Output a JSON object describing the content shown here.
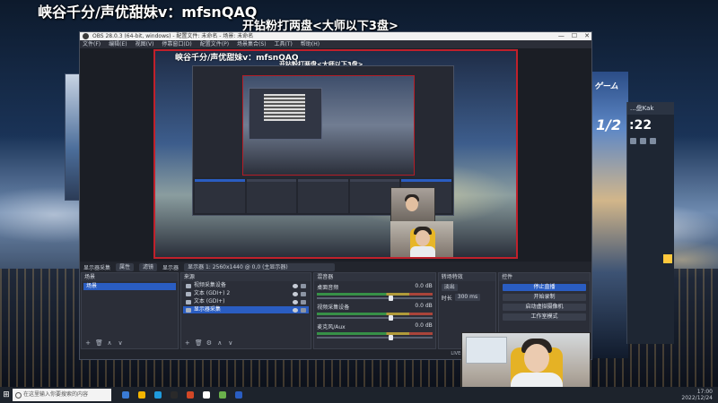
{
  "overlay": {
    "line1": "峡谷千分/声优甜妹v：mfsnQAQ",
    "line2": "开钻粉打两盘<大师以下3盘>"
  },
  "obs": {
    "title": "OBS 28.0.3 (64-bit, windows) - 配置文件: 未命名 - 场景: 未命名",
    "window_controls": [
      "—",
      "☐",
      "✕"
    ],
    "menu": [
      "文件(F)",
      "编辑(E)",
      "视图(V)",
      "停靠窗口(D)",
      "配置文件(P)",
      "场景集合(S)",
      "工具(T)",
      "帮助(H)"
    ],
    "canvas_overlay": {
      "line1": "峡谷千分/声优甜妹v：mfsnQAQ",
      "line2": "开钻粉打两盘<大师以下3盘>"
    },
    "source_toolbar": {
      "selected": "显示器采集",
      "properties": "属性",
      "filters": "滤镜",
      "display_label": "显示器",
      "display_value": "显示器 1: 2560x1440 @ 0,0 (主显示器)"
    },
    "scenes": {
      "title": "场景",
      "items": [
        "场景"
      ],
      "footer": [
        "+",
        "🗑",
        "∧",
        "∨"
      ]
    },
    "sources": {
      "title": "来源",
      "items": [
        {
          "name": "视频采集设备"
        },
        {
          "name": "文本 (GDI+) 2"
        },
        {
          "name": "文本 (GDI+)"
        },
        {
          "name": "显示器采集"
        }
      ],
      "footer": [
        "+",
        "🗑",
        "⚙",
        "∧",
        "∨"
      ]
    },
    "mixer": {
      "title": "混音器",
      "tracks": [
        {
          "name": "桌面音频",
          "db": "0.0 dB"
        },
        {
          "name": "视频采集设备",
          "db": "0.0 dB"
        },
        {
          "name": "麦克风/Aux",
          "db": "0.0 dB"
        }
      ]
    },
    "transitions": {
      "title": "转场特效",
      "type": "淡出",
      "duration_label": "时长",
      "duration_value": "300 ms"
    },
    "controls": {
      "title": "控件",
      "buttons": [
        "停止直播",
        "开始录制",
        "启动虚拟摄像机",
        "工作室模式"
      ]
    },
    "statusbar": "LIVE: 00:00:00"
  },
  "taskbar": {
    "search_placeholder": "在这里输入你要搜索的内容",
    "time": "17:00",
    "date": "2022/12/24",
    "app_colors": [
      "#3a7bd5",
      "#f3b400",
      "#1f9bde",
      "#2a2a2a",
      "#d24726",
      "#ffffff",
      "#6ab04c",
      "#2a5dc2"
    ]
  },
  "side_game": {
    "text": "ゲーム",
    "num": "1/2",
    "chat_time": ":22",
    "chat_head": "...盘Kak"
  }
}
